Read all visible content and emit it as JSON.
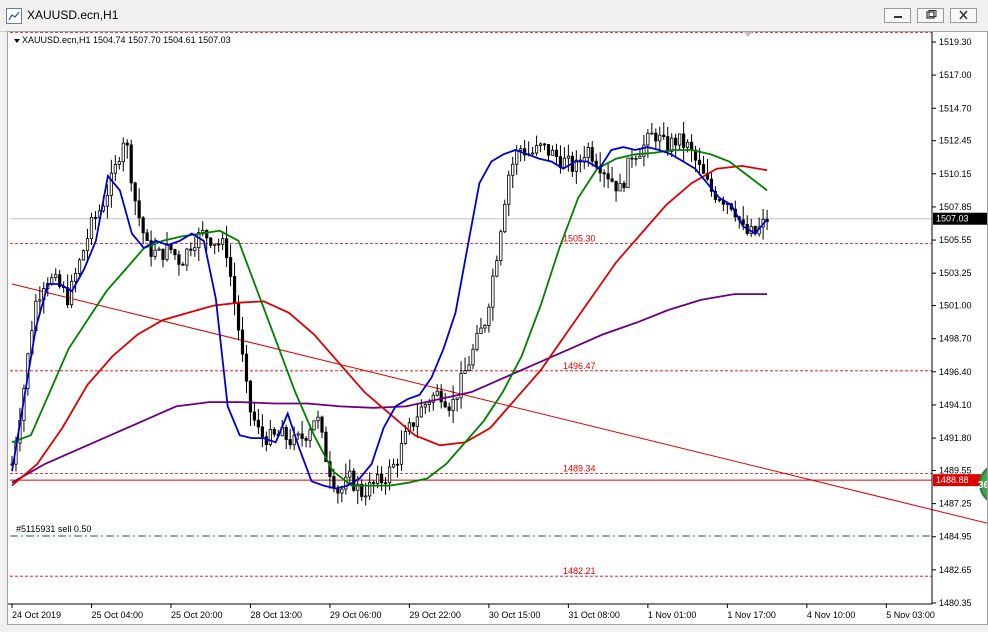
{
  "window": {
    "title": "XAUUSD.ecn,H1"
  },
  "chart_header": {
    "symbol_info": "XAUUSD.ecn,H1  1504.74 1507.70 1504.61 1507.03"
  },
  "colors": {
    "background": "#ffffff",
    "candles": "#000000",
    "ma_fast": "#0000cd",
    "ma_medium": "#008000",
    "ma_slow": "#dc0000",
    "ma_slowest": "#6a0080",
    "level_lines": "#dc0000",
    "order_line": "#008000",
    "price_label_bg": "#dc0000",
    "current_price_bg": "#000000"
  },
  "chart_data": {
    "type": "candlestick",
    "symbol": "XAUUSD.ecn",
    "timeframe": "H1",
    "ohlc_last": {
      "open": 1504.74,
      "high": 1507.7,
      "low": 1504.61,
      "close": 1507.03
    },
    "y_axis_ticks": [
      "1519.30",
      "1517.00",
      "1514.70",
      "1512.45",
      "1510.15",
      "1507.85",
      "1505.55",
      "1503.25",
      "1501.00",
      "1498.70",
      "1496.40",
      "1494.10",
      "1491.80",
      "1489.55",
      "1487.25",
      "1484.95",
      "1482.65",
      "1480.35"
    ],
    "ylim": [
      1480.35,
      1519.3
    ],
    "x_axis_ticks": [
      "24 Oct 2019",
      "25 Oct 04:00",
      "25 Oct 20:00",
      "28 Oct 13:00",
      "29 Oct 06:00",
      "29 Oct 22:00",
      "30 Oct 15:00",
      "31 Oct 08:00",
      "1 Nov 01:00",
      "1 Nov 17:00",
      "4 Nov 10:00",
      "5 Nov 03:00"
    ],
    "current_price": "1507.03",
    "horizontal_levels": [
      {
        "label": "1519.97",
        "value": 1519.97
      },
      {
        "label": "1505.30",
        "value": 1505.3
      },
      {
        "label": "1496.47",
        "value": 1496.47
      },
      {
        "label": "1489.34",
        "value": 1489.34
      },
      {
        "label": "1482.21",
        "value": 1482.21
      }
    ],
    "red_level": {
      "label": "1488.88",
      "value": 1488.88
    },
    "order_line": {
      "label": "#5115931 sell 0.50",
      "value": 1485.0
    },
    "trendline": {
      "start": {
        "bar": 0,
        "price": 1502.5
      },
      "end": {
        "bar": 232,
        "price": 1486.8
      }
    },
    "close_path": [
      1490.0,
      1495.0,
      1501.0,
      1503.0,
      1502.5,
      1501.5,
      1504.0,
      1506.5,
      1508.0,
      1510.0,
      1513.0,
      1508.0,
      1505.0,
      1504.5,
      1505.0,
      1504.0,
      1505.5,
      1506.0,
      1505.5,
      1505.0,
      1500.0,
      1494.0,
      1492.0,
      1491.8,
      1492.0,
      1491.5,
      1492.0,
      1493.5,
      1490.0,
      1488.0,
      1489.0,
      1488.0,
      1488.5,
      1489.0,
      1490.0,
      1492.0,
      1493.5,
      1494.5,
      1495.0,
      1494.0,
      1496.0,
      1498.0,
      1500.0,
      1504.5,
      1510.0,
      1512.0,
      1511.5,
      1512.0,
      1511.5,
      1511.0,
      1510.5,
      1512.0,
      1511.0,
      1510.0,
      1509.0,
      1511.5,
      1512.0,
      1513.0,
      1512.0,
      1512.5,
      1512.0,
      1510.5,
      1509.0,
      1508.5,
      1508.0,
      1506.0,
      1506.0,
      1507.0
    ],
    "ma_fast_path": [
      1489.5,
      1494.5,
      1499.5,
      1502.5,
      1502.5,
      1502.0,
      1503.5,
      1505.5,
      1510.0,
      1509.0,
      1506.0,
      1505.0,
      1505.5,
      1505.2,
      1505.5,
      1506.0,
      1505.5,
      1501.5,
      1494.0,
      1492.0,
      1491.8,
      1491.8,
      1491.5,
      1493.5,
      1491.0,
      1488.8,
      1488.5,
      1488.3,
      1488.5,
      1489.0,
      1490.0,
      1492.5,
      1494.0,
      1494.5,
      1494.8,
      1496.0,
      1498.0,
      1500.5,
      1505.0,
      1509.5,
      1511.0,
      1511.5,
      1511.8,
      1511.5,
      1511.2,
      1511.0,
      1510.5,
      1511.0,
      1511.0,
      1510.5,
      1511.8,
      1512.0,
      1511.8,
      1512.0,
      1511.8,
      1511.5,
      1511.0,
      1510.5,
      1509.5,
      1508.5,
      1508.0,
      1506.5,
      1506.0,
      1507.0
    ],
    "ma_medium_path": [
      1491.5,
      1492.0,
      1495.0,
      1498.0,
      1500.0,
      1502.0,
      1503.5,
      1505.0,
      1505.5,
      1505.8,
      1506.0,
      1506.2,
      1505.5,
      1502.0,
      1498.5,
      1495.0,
      1492.0,
      1489.5,
      1488.5,
      1488.5,
      1488.5,
      1488.7,
      1489.0,
      1490.0,
      1491.5,
      1493.0,
      1495.0,
      1497.5,
      1501.0,
      1505.0,
      1508.5,
      1510.5,
      1511.2,
      1511.5,
      1511.6,
      1511.8,
      1511.8,
      1511.5,
      1511.0,
      1510.0,
      1509.0
    ],
    "ma_slow_path": [
      1488.5,
      1490.0,
      1492.5,
      1495.5,
      1497.5,
      1499.0,
      1500.0,
      1500.5,
      1501.0,
      1501.2,
      1501.3,
      1500.5,
      1499.0,
      1497.0,
      1495.0,
      1493.5,
      1492.0,
      1491.3,
      1491.5,
      1492.5,
      1494.5,
      1496.5,
      1499.0,
      1501.5,
      1504.0,
      1506.0,
      1508.0,
      1509.5,
      1510.5,
      1510.7,
      1510.4
    ],
    "ma_slowest_path": [
      1488.7,
      1490.0,
      1491.0,
      1492.0,
      1493.0,
      1494.0,
      1494.3,
      1494.3,
      1494.2,
      1494.2,
      1494.0,
      1493.9,
      1494.0,
      1494.5,
      1495.0,
      1496.0,
      1497.0,
      1498.0,
      1499.0,
      1499.8,
      1500.7,
      1501.4,
      1501.8,
      1501.8
    ]
  }
}
